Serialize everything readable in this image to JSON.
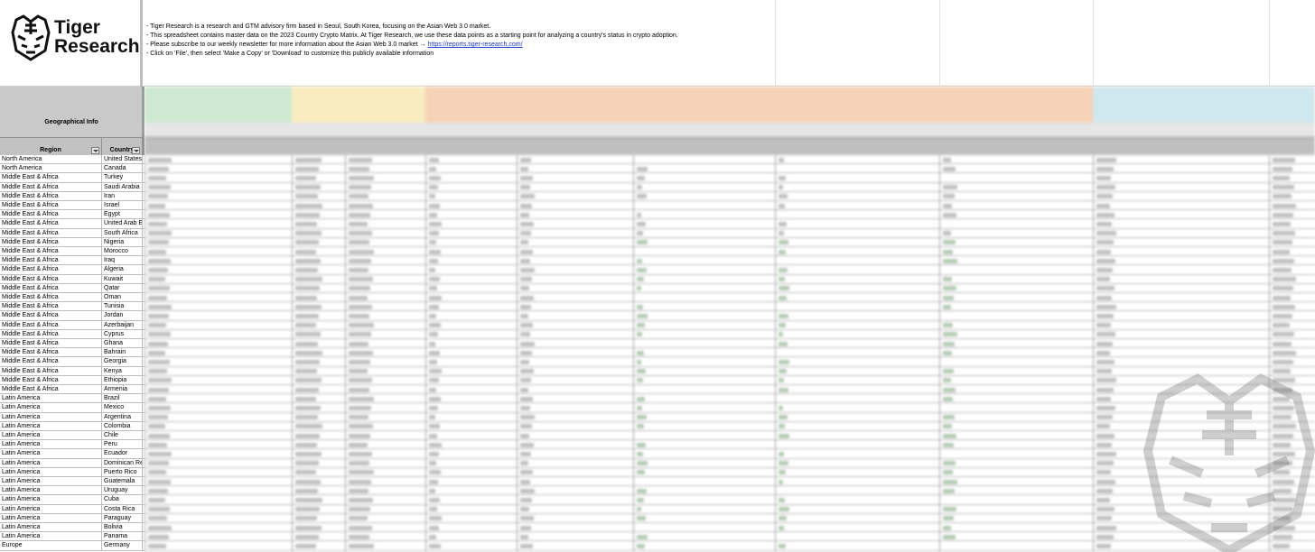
{
  "brand": {
    "name_line1": "Tiger",
    "name_line2": "Research",
    "logo_icon": "tiger-head-icon"
  },
  "info_lines": [
    "- Tiger Research is a research and GTM advisory firm based in Seoul, South Korea, focusing on the Asian Web 3.0 market.",
    "- This spreadsheet contains master data on the 2023 Country Crypto Matrix. At Tiger Research, we use these data points as a starting point for analyzing a country's status in crypto adoption.",
    "- Please subscribe to our weekly newsletter for more information about the Asian Web 3.0 market → ",
    "- Click on 'File', then select 'Make a Copy' or 'Download' to customize this publicly available information"
  ],
  "newsletter_link": "https://reports.tiger-research.com/",
  "header": {
    "group_label": "Geographical Info",
    "region_col": "Region",
    "country_col": "Country"
  },
  "bands": [
    {
      "color": "#cfe8d2"
    },
    {
      "color": "#f8ecc0"
    },
    {
      "color": "#f6d3b6"
    },
    {
      "color": "#cfe7ee"
    }
  ],
  "rows": [
    {
      "region": "North America",
      "country": "United States"
    },
    {
      "region": "North America",
      "country": "Canada"
    },
    {
      "region": "Middle East & Africa",
      "country": "Turkey"
    },
    {
      "region": "Middle East & Africa",
      "country": "Saudi Arabia"
    },
    {
      "region": "Middle East & Africa",
      "country": "Iran"
    },
    {
      "region": "Middle East & Africa",
      "country": "Israel"
    },
    {
      "region": "Middle East & Africa",
      "country": "Egypt"
    },
    {
      "region": "Middle East & Africa",
      "country": "United Arab E"
    },
    {
      "region": "Middle East & Africa",
      "country": "South Africa"
    },
    {
      "region": "Middle East & Africa",
      "country": "Nigeria"
    },
    {
      "region": "Middle East & Africa",
      "country": "Morocco"
    },
    {
      "region": "Middle East & Africa",
      "country": "Iraq"
    },
    {
      "region": "Middle East & Africa",
      "country": "Algeria"
    },
    {
      "region": "Middle East & Africa",
      "country": "Kuwait"
    },
    {
      "region": "Middle East & Africa",
      "country": "Qatar"
    },
    {
      "region": "Middle East & Africa",
      "country": "Oman"
    },
    {
      "region": "Middle East & Africa",
      "country": "Tunisia"
    },
    {
      "region": "Middle East & Africa",
      "country": "Jordan"
    },
    {
      "region": "Middle East & Africa",
      "country": "Azerbaijan"
    },
    {
      "region": "Middle East & Africa",
      "country": "Cyprus"
    },
    {
      "region": "Middle East & Africa",
      "country": "Ghana"
    },
    {
      "region": "Middle East & Africa",
      "country": "Bahrain"
    },
    {
      "region": "Middle East & Africa",
      "country": "Georgia"
    },
    {
      "region": "Middle East & Africa",
      "country": "Kenya"
    },
    {
      "region": "Middle East & Africa",
      "country": "Ethiopia"
    },
    {
      "region": "Middle East & Africa",
      "country": "Armenia"
    },
    {
      "region": "Latin America",
      "country": "Brazil"
    },
    {
      "region": "Latin America",
      "country": "Mexico"
    },
    {
      "region": "Latin America",
      "country": "Argentina"
    },
    {
      "region": "Latin America",
      "country": "Colombia"
    },
    {
      "region": "Latin America",
      "country": "Chile"
    },
    {
      "region": "Latin America",
      "country": "Peru"
    },
    {
      "region": "Latin America",
      "country": "Ecuador"
    },
    {
      "region": "Latin America",
      "country": "Dominican Re"
    },
    {
      "region": "Latin America",
      "country": "Puerto Rico"
    },
    {
      "region": "Latin America",
      "country": "Guatemala"
    },
    {
      "region": "Latin America",
      "country": "Uruguay"
    },
    {
      "region": "Latin America",
      "country": "Cuba"
    },
    {
      "region": "Latin America",
      "country": "Costa Rica"
    },
    {
      "region": "Latin America",
      "country": "Paraguay"
    },
    {
      "region": "Latin America",
      "country": "Bolivia"
    },
    {
      "region": "Latin America",
      "country": "Panama"
    },
    {
      "region": "Europe",
      "country": "Germany"
    }
  ]
}
